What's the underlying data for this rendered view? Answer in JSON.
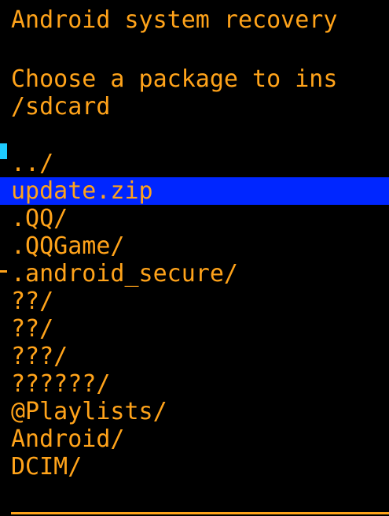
{
  "header": {
    "title": "Android system recovery",
    "prompt": "Choose a package to ins",
    "path": "/sdcard"
  },
  "files": {
    "items": [
      "../",
      "update.zip",
      ".QQ/",
      ".QQGame/",
      ".android_secure/",
      "??/",
      "??/",
      "???/",
      "??????/",
      "@Playlists/",
      "Android/",
      "DCIM/"
    ],
    "selected": "update.zip"
  },
  "colors": {
    "text": "#ffa31a",
    "background": "#000000",
    "highlight": "#0026ff",
    "scroll_marker": "#1ecbff"
  }
}
